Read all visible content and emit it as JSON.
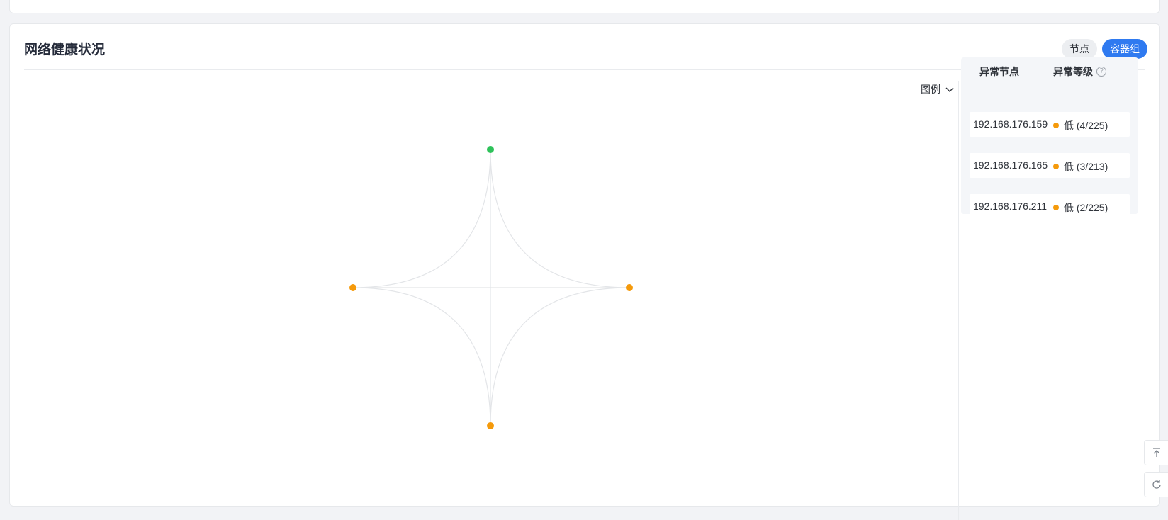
{
  "section": {
    "title": "网络健康状况",
    "toggle_node": "节点",
    "toggle_pod": "容器组",
    "legend_label": "图例"
  },
  "graph": {
    "nodes": [
      {
        "id": "top",
        "status": "healthy",
        "color": "#2ec25a"
      },
      {
        "id": "left",
        "status": "low",
        "color": "#f59a0b"
      },
      {
        "id": "right",
        "status": "low",
        "color": "#f59a0b"
      },
      {
        "id": "bottom",
        "status": "low",
        "color": "#f59a0b"
      }
    ],
    "edge_color": "#e3e5e8"
  },
  "anomaly_panel": {
    "col_node": "异常节点",
    "col_level": "异常等级",
    "help_icon": "?",
    "rows": [
      {
        "ip": "192.168.176.159",
        "level": "低 (4/225)",
        "color": "#f59a0b"
      },
      {
        "ip": "192.168.176.165",
        "level": "低 (3/213)",
        "color": "#f59a0b"
      },
      {
        "ip": "192.168.176.211",
        "level": "低 (2/225)",
        "color": "#f59a0b"
      }
    ]
  },
  "icons": {
    "back_to_top": "arrow-up-to-line-icon",
    "refresh": "refresh-icon"
  }
}
